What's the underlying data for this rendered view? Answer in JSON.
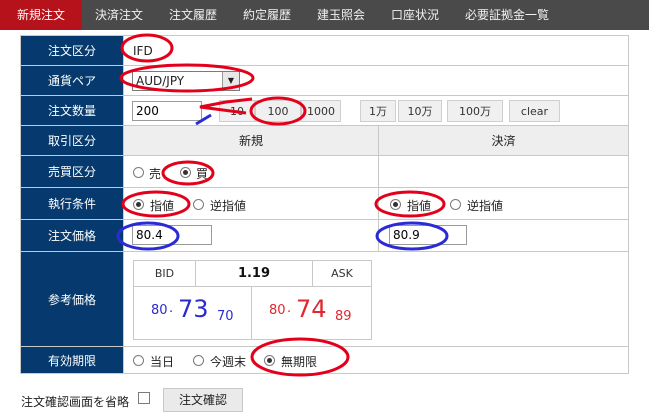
{
  "tabs": [
    "新規注文",
    "決済注文",
    "注文履歴",
    "約定履歴",
    "建玉照会",
    "口座状況",
    "必要証拠金一覧"
  ],
  "form": {
    "order_type_label": "注文区分",
    "order_type_value": "IFD",
    "pair_label": "通貨ペア",
    "pair_value": "AUD/JPY",
    "qty_label": "注文数量",
    "qty_value": "200",
    "qty_buttons": [
      "10",
      "100",
      "1000",
      "1万",
      "10万",
      "100万",
      "clear"
    ],
    "trade_type_label": "取引区分",
    "col_new": "新規",
    "col_settle": "決済",
    "side_label": "売買区分",
    "side_sell": "売",
    "side_buy": "買",
    "exec_label": "執行条件",
    "exec_limit": "指値",
    "exec_stop": "逆指値",
    "price_label": "注文価格",
    "new_price": "80.4",
    "settle_price": "80.9",
    "ref_label": "参考価格",
    "bid_label": "BID",
    "spread": "1.19",
    "ask_label": "ASK",
    "bid_a": "80",
    "bid_b": "73",
    "bid_c": "70",
    "ask_a": "80",
    "ask_b": "74",
    "ask_c": "89",
    "validity_label": "有効期限",
    "validity_today": "当日",
    "validity_week": "今週末",
    "validity_none": "無期限"
  },
  "footer": {
    "skip_confirm_label": "注文確認画面を省略",
    "confirm_button": "注文確認"
  },
  "colors": {
    "tab_bar": "#4a4a4a",
    "tab_active": "#b5121b",
    "label_bg": "#063a6e",
    "bid_color": "#2a2ad0",
    "ask_color": "#e0262e",
    "annotation_red": "#e3001b",
    "annotation_blue": "#2b2bd6"
  }
}
